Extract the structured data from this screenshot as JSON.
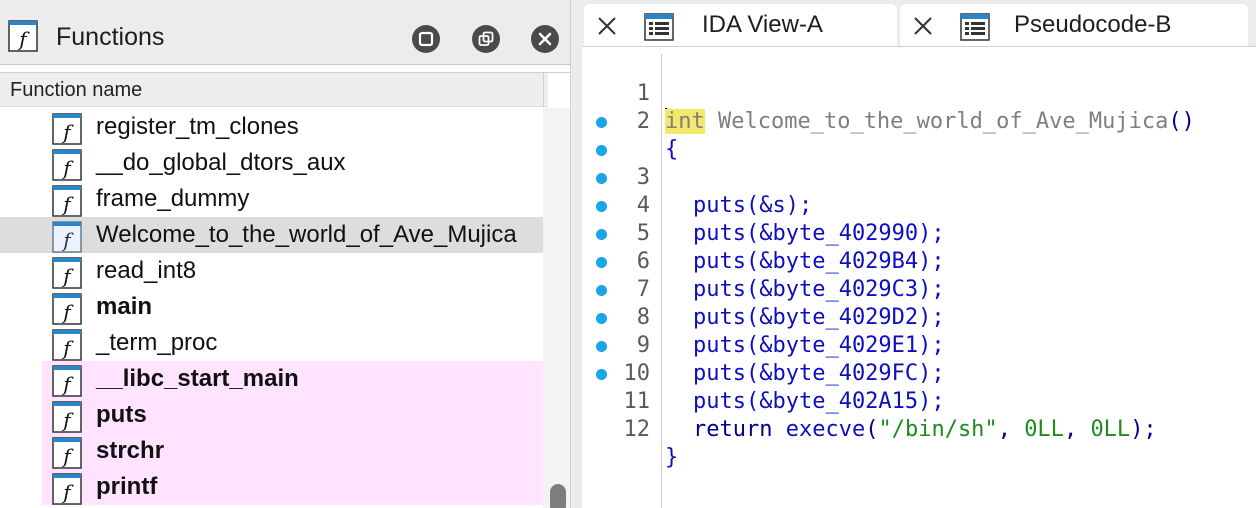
{
  "functions_pane": {
    "title": "Functions",
    "column_header": "Function name",
    "rows": [
      {
        "name": "register_tm_clones",
        "bold": false,
        "selected": false,
        "imported": false
      },
      {
        "name": "__do_global_dtors_aux",
        "bold": false,
        "selected": false,
        "imported": false
      },
      {
        "name": "frame_dummy",
        "bold": false,
        "selected": false,
        "imported": false
      },
      {
        "name": "Welcome_to_the_world_of_Ave_Mujica",
        "bold": false,
        "selected": true,
        "imported": false
      },
      {
        "name": "read_int8",
        "bold": false,
        "selected": false,
        "imported": false
      },
      {
        "name": "main",
        "bold": true,
        "selected": false,
        "imported": false
      },
      {
        "name": "_term_proc",
        "bold": false,
        "selected": false,
        "imported": false
      },
      {
        "name": "__libc_start_main",
        "bold": true,
        "selected": false,
        "imported": true
      },
      {
        "name": "puts",
        "bold": true,
        "selected": false,
        "imported": true
      },
      {
        "name": "strchr",
        "bold": true,
        "selected": false,
        "imported": true
      },
      {
        "name": "printf",
        "bold": true,
        "selected": false,
        "imported": true
      }
    ]
  },
  "tabs": [
    {
      "label": "IDA View-A"
    },
    {
      "label": "Pseudocode-B"
    }
  ],
  "code": {
    "signature_type": "int",
    "signature_rest": " Welcome_to_the_world_of_Ave_Mujica",
    "signature_parens": "()",
    "open_brace": "{",
    "close_brace": "}",
    "puts_calls": [
      "puts(&s);",
      "puts(&byte_402990);",
      "puts(&byte_4029B4);",
      "puts(&byte_4029C3);",
      "puts(&byte_4029D2);",
      "puts(&byte_4029E1);",
      "puts(&byte_4029FC);",
      "puts(&byte_402A15);"
    ],
    "return_kw": "return",
    "return_func": "execve",
    "return_open": "(",
    "return_str": "\"/bin/sh\"",
    "return_comma1": ", ",
    "return_arg1": "0LL",
    "return_comma2": ", ",
    "return_arg2": "0LL",
    "return_close": ");",
    "line_numbers": [
      "1",
      "2",
      "3",
      "4",
      "5",
      "6",
      "7",
      "8",
      "9",
      "10",
      "11",
      "12"
    ]
  },
  "colors": {
    "bullet": "#1aa5e8",
    "imported_row_bg": "#ffe3ff",
    "selected_row_bg": "#dddddd",
    "keyword_highlight": "#f2e86a"
  },
  "icons": {
    "function": "function-f-icon",
    "tab_ida_view": "listing-icon",
    "tab_pseudocode": "listing-icon",
    "close": "close-icon"
  }
}
